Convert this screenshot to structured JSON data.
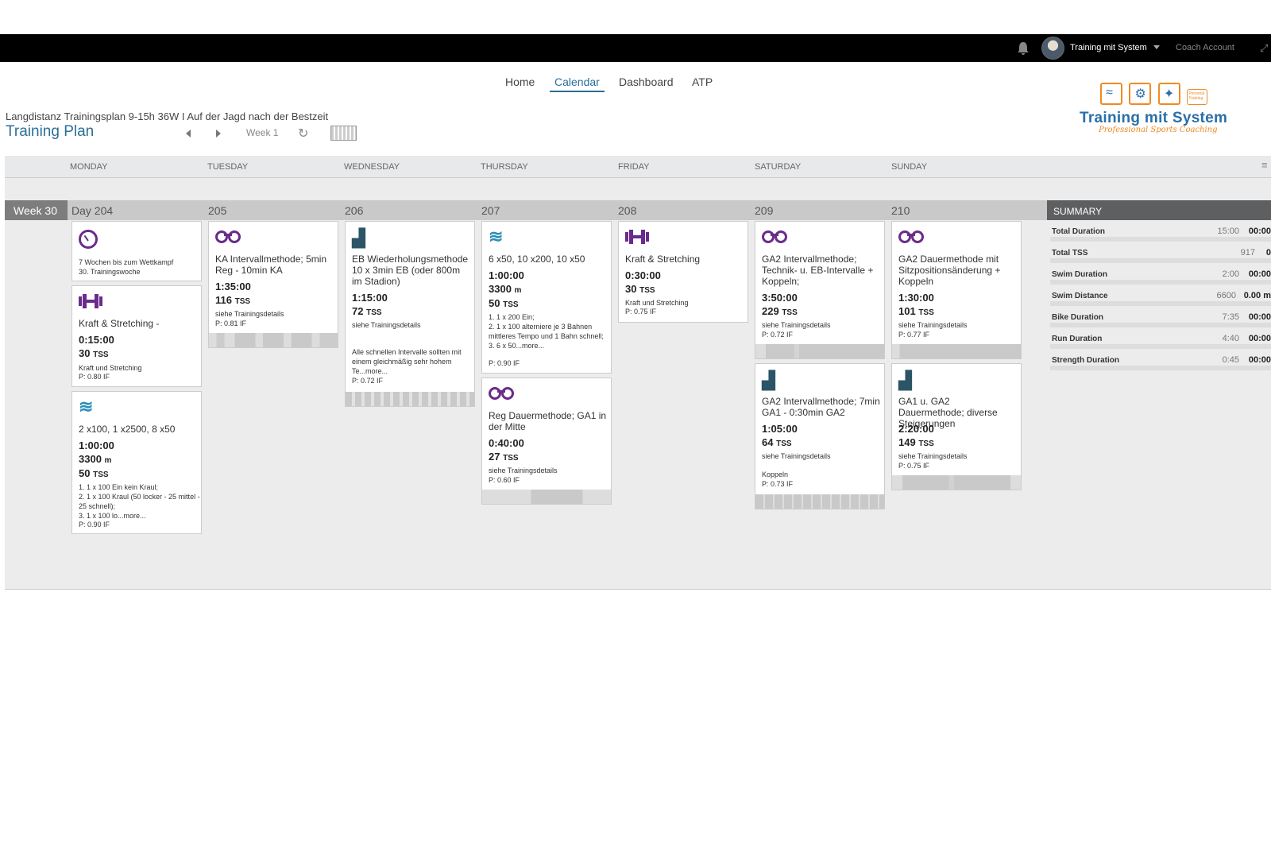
{
  "topbar": {
    "user_name": "Training mit System",
    "coach_account": "Coach Account"
  },
  "nav": {
    "items": [
      "Home",
      "Calendar",
      "Dashboard",
      "ATP"
    ],
    "active": "Calendar"
  },
  "plan": {
    "subtitle": "Langdistanz Trainingsplan 9-15h 36W I Auf der Jagd nach der Bestzeit",
    "title": "Training Plan",
    "week_label": "Week 1"
  },
  "logo": {
    "brand": "Training mit System",
    "tagline": "Professional Sports Coaching",
    "badge": "Personal Training"
  },
  "days": [
    "MONDAY",
    "TUESDAY",
    "WEDNESDAY",
    "THURSDAY",
    "FRIDAY",
    "SATURDAY",
    "SUNDAY"
  ],
  "week": {
    "label": "Week 30",
    "day_numbers": [
      "Day 204",
      "205",
      "206",
      "207",
      "208",
      "209",
      "210"
    ]
  },
  "summary": {
    "title": "SUMMARY",
    "rows": [
      {
        "label": "Total Duration",
        "value": "15:00",
        "bold": "00:00"
      },
      {
        "label": "Total TSS",
        "value": "917",
        "bold": "0"
      },
      {
        "label": "Swim Duration",
        "value": "2:00",
        "bold": "00:00"
      },
      {
        "label": "Swim Distance",
        "value": "6600",
        "bold": "0.00 m"
      },
      {
        "label": "Bike Duration",
        "value": "7:35",
        "bold": "00:00"
      },
      {
        "label": "Run Duration",
        "value": "4:40",
        "bold": "00:00"
      },
      {
        "label": "Strength Duration",
        "value": "0:45",
        "bold": "00:00"
      }
    ]
  },
  "cards": {
    "mon_note": {
      "icon": "stopwatch-icon",
      "line1": "7 Wochen bis zum Wettkampf",
      "line2": "30. Trainingswoche"
    },
    "mon_strength": {
      "icon": "dumbbell-icon",
      "title": "Kraft & Stretching -",
      "duration": "0:15:00",
      "tss": "30",
      "tss_unit": "TSS",
      "desc": "Kraft und Stretching",
      "if": "P: 0.80 IF"
    },
    "mon_swim": {
      "icon": "swim-icon",
      "title": "2 x100, 1 x2500, 8 x50",
      "duration": "1:00:00",
      "distance": "3300",
      "distance_unit": "m",
      "tss": "50",
      "tss_unit": "TSS",
      "desc": "1. 1 x 100 Ein kein Kraul;\n2. 1 x 100 Kraul (50 locker - 25 mittel - 25 schnell);\n3. 1 x 100 lo...more...",
      "if": "P: 0.90 IF"
    },
    "tue_bike": {
      "icon": "bike-icon",
      "title": "KA Intervallmethode; 5min Reg - 10min KA",
      "duration": "1:35:00",
      "tss": "116",
      "tss_unit": "TSS",
      "desc": "siehe Trainingsdetails",
      "if": "P: 0.81 IF"
    },
    "wed_run": {
      "icon": "run-shoe-icon",
      "title": "EB Wiederholungsmethode 10 x 3min EB (oder 800m im Stadion)",
      "duration": "1:15:00",
      "tss": "72",
      "tss_unit": "TSS",
      "desc": "siehe Trainingsdetails",
      "desc2": "Alle schnellen Intervalle sollten mit einem gleichmäßig sehr hohem Te...more...",
      "if": "P: 0.72 IF"
    },
    "thu_swim": {
      "icon": "swim-icon",
      "title": "6 x50, 10 x200, 10 x50",
      "duration": "1:00:00",
      "distance": "3300",
      "distance_unit": "m",
      "tss": "50",
      "tss_unit": "TSS",
      "desc": "1. 1 x 200 Ein;\n2. 1 x 100 alterniere je 3 Bahnen mittleres Tempo und 1 Bahn schnell;\n3. 6 x 50...more...",
      "if": "P: 0.90 IF"
    },
    "thu_bike": {
      "icon": "bike-icon",
      "title": "Reg Dauermethode; GA1 in der Mitte",
      "duration": "0:40:00",
      "tss": "27",
      "tss_unit": "TSS",
      "desc": "siehe Trainingsdetails",
      "if": "P: 0.60 IF"
    },
    "fri_strength": {
      "icon": "dumbbell-icon",
      "title": "Kraft & Stretching",
      "duration": "0:30:00",
      "tss": "30",
      "tss_unit": "TSS",
      "desc": "Kraft und Stretching",
      "if": "P: 0.75 IF"
    },
    "sat_bike": {
      "icon": "bike-icon",
      "title": "GA2 Intervallmethode; Technik- u. EB-Intervalle + Koppeln;",
      "duration": "3:50:00",
      "tss": "229",
      "tss_unit": "TSS",
      "desc": "siehe Trainingsdetails",
      "if": "P: 0.72 IF"
    },
    "sat_run": {
      "icon": "run-shoe-icon",
      "title": "GA2 Intervallmethode; 7min GA1 - 0:30min GA2",
      "duration": "1:05:00",
      "tss": "64",
      "tss_unit": "TSS",
      "desc": "siehe Trainingsdetails",
      "desc2": "Koppeln",
      "if": "P: 0.73 IF"
    },
    "sun_bike": {
      "icon": "bike-icon",
      "title": "GA2 Dauermethode mit Sitzpositionsänderung + Koppeln",
      "duration": "1:30:00",
      "tss": "101",
      "tss_unit": "TSS",
      "desc": "siehe Trainingsdetails",
      "if": "P: 0.77 IF"
    },
    "sun_run": {
      "icon": "run-shoe-icon",
      "title": "GA1 u. GA2 Dauermethode; diverse Steigerungen",
      "duration": "2:20:00",
      "tss": "149",
      "tss_unit": "TSS",
      "desc": "siehe Trainingsdetails",
      "if": "P: 0.75 IF"
    }
  },
  "colors": {
    "accent": "#2a6f97",
    "bike": "#6a2c8a",
    "swim": "#2a8fb8",
    "run": "#2b5566",
    "logo_orange": "#f08a24"
  }
}
